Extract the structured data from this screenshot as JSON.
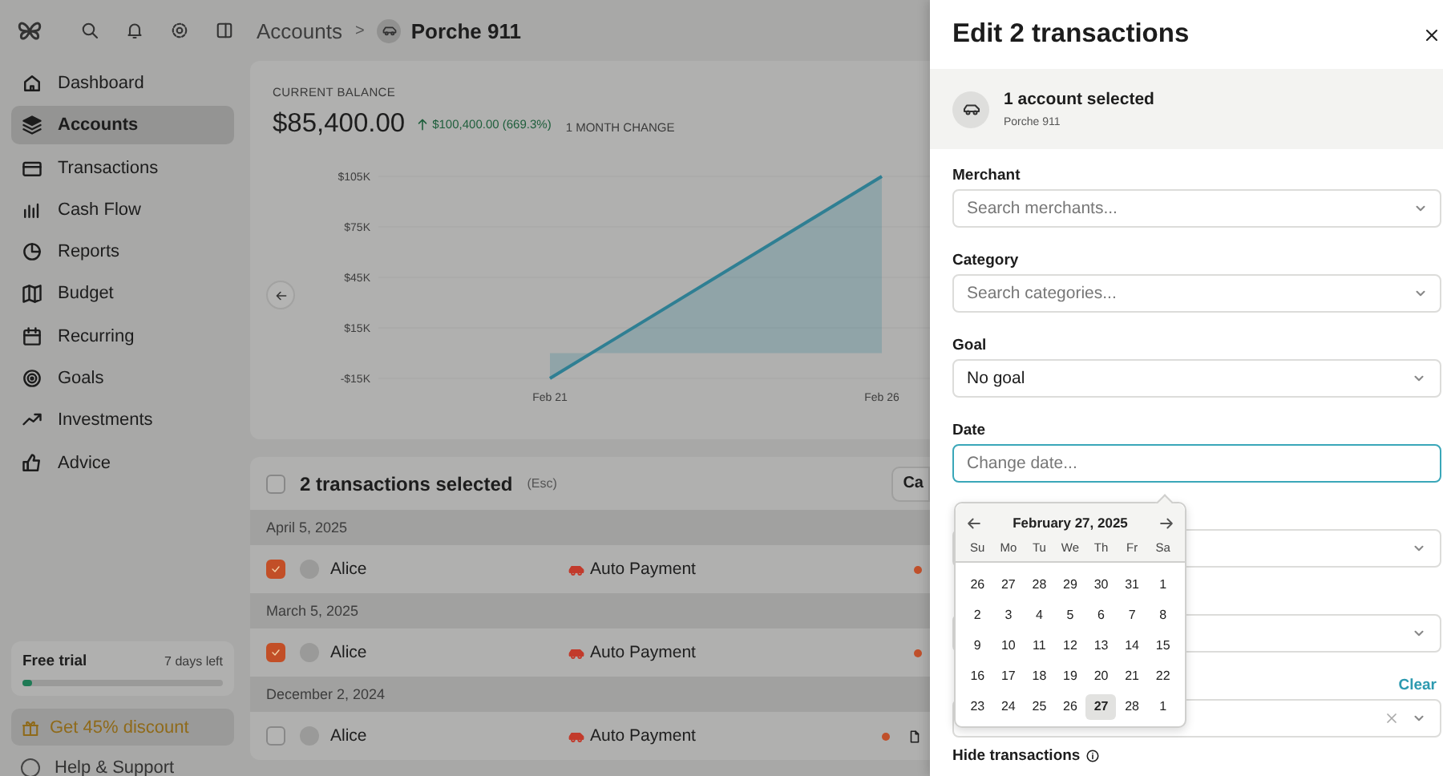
{
  "sidebar": {
    "nav": [
      {
        "label": "Dashboard",
        "selected": false
      },
      {
        "label": "Accounts",
        "selected": true
      },
      {
        "label": "Transactions",
        "selected": false
      },
      {
        "label": "Cash Flow",
        "selected": false
      },
      {
        "label": "Reports",
        "selected": false
      },
      {
        "label": "Budget",
        "selected": false
      },
      {
        "label": "Recurring",
        "selected": false
      },
      {
        "label": "Goals",
        "selected": false
      },
      {
        "label": "Investments",
        "selected": false
      },
      {
        "label": "Advice",
        "selected": false
      }
    ],
    "trial": {
      "title": "Free trial",
      "days_left": "7 days left",
      "level": 0.05
    },
    "discount_button": "Get 45% discount",
    "help": "Help & Support"
  },
  "breadcrumb": {
    "parent": "Accounts",
    "separator": ">",
    "current": "Porche 911"
  },
  "balance": {
    "label": "CURRENT BALANCE",
    "amount": "$85,400.00",
    "change": "$100,400.00 (669.3%)",
    "period": "1 MONTH CHANGE",
    "chart_data": {
      "type": "area",
      "x": [
        "Feb 21",
        "Feb 26"
      ],
      "values": [
        -15000,
        105000
      ],
      "ylim": [
        -15000,
        105000
      ],
      "yticks": [
        {
          "value": 105000,
          "label": "$105K"
        },
        {
          "value": 75000,
          "label": "$75K"
        },
        {
          "value": 45000,
          "label": "$45K"
        },
        {
          "value": 15000,
          "label": "$15K"
        },
        {
          "value": -15000,
          "label": "-$15K"
        }
      ]
    }
  },
  "selection": {
    "title": "2 transactions selected",
    "hint": "(Esc)",
    "button": "Ca",
    "checked": false
  },
  "groups": [
    {
      "date": "April 5, 2025",
      "rows": [
        {
          "merchant": "Alice",
          "category": "Auto Payment",
          "checked": true,
          "attachment": false
        }
      ]
    },
    {
      "date": "March 5, 2025",
      "rows": [
        {
          "merchant": "Alice",
          "category": "Auto Payment",
          "checked": true,
          "attachment": false
        }
      ]
    },
    {
      "date": "December 2, 2024",
      "rows": [
        {
          "merchant": "Alice",
          "category": "Auto Payment",
          "checked": false,
          "attachment": true
        }
      ]
    }
  ],
  "panel": {
    "title": "Edit 2 transactions",
    "account": {
      "title": "1 account selected",
      "name": "Porche 911"
    },
    "fields": [
      {
        "label": "Merchant",
        "placeholder": "Search merchants..."
      },
      {
        "label": "Category",
        "placeholder": "Search categories..."
      },
      {
        "label": "Goal",
        "value": "No goal"
      },
      {
        "label": "Date",
        "placeholder": "Change date...",
        "focused": true
      },
      {
        "focused": false
      },
      {
        "focused": false
      },
      {
        "clear": "Clear",
        "focused": false
      }
    ],
    "hide_label": "Hide transactions",
    "calendar": {
      "month": "February 27, 2025",
      "weekdays": [
        "Su",
        "Mo",
        "Tu",
        "We",
        "Th",
        "Fr",
        "Sa"
      ],
      "weeks": [
        [
          {
            "day": "26",
            "selected": false
          },
          {
            "day": "27",
            "selected": false
          },
          {
            "day": "28",
            "selected": false
          },
          {
            "day": "29",
            "selected": false
          },
          {
            "day": "30",
            "selected": false
          },
          {
            "day": "31",
            "selected": false
          },
          {
            "day": "1",
            "selected": false
          }
        ],
        [
          {
            "day": "2",
            "selected": false
          },
          {
            "day": "3",
            "selected": false
          },
          {
            "day": "4",
            "selected": false
          },
          {
            "day": "5",
            "selected": false
          },
          {
            "day": "6",
            "selected": false
          },
          {
            "day": "7",
            "selected": false
          },
          {
            "day": "8",
            "selected": false
          }
        ],
        [
          {
            "day": "9",
            "selected": false
          },
          {
            "day": "10",
            "selected": false
          },
          {
            "day": "11",
            "selected": false
          },
          {
            "day": "12",
            "selected": false
          },
          {
            "day": "13",
            "selected": false
          },
          {
            "day": "14",
            "selected": false
          },
          {
            "day": "15",
            "selected": false
          }
        ],
        [
          {
            "day": "16",
            "selected": false
          },
          {
            "day": "17",
            "selected": false
          },
          {
            "day": "18",
            "selected": false
          },
          {
            "day": "19",
            "selected": false
          },
          {
            "day": "20",
            "selected": false
          },
          {
            "day": "21",
            "selected": false
          },
          {
            "day": "22",
            "selected": false
          }
        ],
        [
          {
            "day": "23",
            "selected": false
          },
          {
            "day": "24",
            "selected": false
          },
          {
            "day": "25",
            "selected": false
          },
          {
            "day": "26",
            "selected": false
          },
          {
            "day": "27",
            "selected": true
          },
          {
            "day": "28",
            "selected": false
          },
          {
            "day": "1",
            "selected": false
          }
        ]
      ]
    }
  }
}
